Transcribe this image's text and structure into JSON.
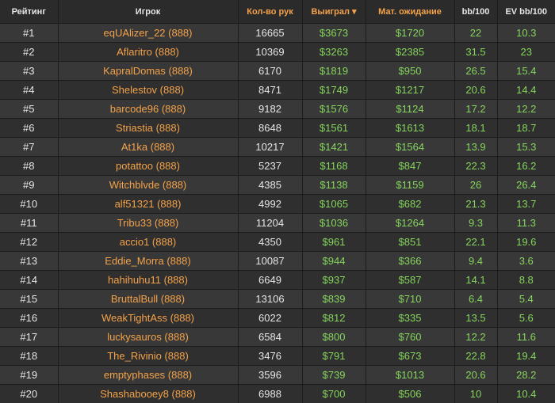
{
  "columns": [
    {
      "key": "rank",
      "label": "Рейтинг"
    },
    {
      "key": "player",
      "label": "Игрок"
    },
    {
      "key": "hands",
      "label": "Кол-во рук"
    },
    {
      "key": "won",
      "label": "Выиграл"
    },
    {
      "key": "ev",
      "label": "Мат. ожидание"
    },
    {
      "key": "bb",
      "label": "bb/100"
    },
    {
      "key": "evbb",
      "label": "EV bb/100"
    }
  ],
  "rows": [
    {
      "rank": "#1",
      "player": "eqUAlizer_22 (888)",
      "hands": "16665",
      "won": "$3673",
      "ev": "$1720",
      "bb": "22",
      "evbb": "10.3"
    },
    {
      "rank": "#2",
      "player": "Aflaritro (888)",
      "hands": "10369",
      "won": "$3263",
      "ev": "$2385",
      "bb": "31.5",
      "evbb": "23"
    },
    {
      "rank": "#3",
      "player": "KapralDomas (888)",
      "hands": "6170",
      "won": "$1819",
      "ev": "$950",
      "bb": "26.5",
      "evbb": "15.4"
    },
    {
      "rank": "#4",
      "player": "Shelestov (888)",
      "hands": "8471",
      "won": "$1749",
      "ev": "$1217",
      "bb": "20.6",
      "evbb": "14.4"
    },
    {
      "rank": "#5",
      "player": "barcode96 (888)",
      "hands": "9182",
      "won": "$1576",
      "ev": "$1124",
      "bb": "17.2",
      "evbb": "12.2"
    },
    {
      "rank": "#6",
      "player": "Striastia (888)",
      "hands": "8648",
      "won": "$1561",
      "ev": "$1613",
      "bb": "18.1",
      "evbb": "18.7"
    },
    {
      "rank": "#7",
      "player": "At1ka (888)",
      "hands": "10217",
      "won": "$1421",
      "ev": "$1564",
      "bb": "13.9",
      "evbb": "15.3"
    },
    {
      "rank": "#8",
      "player": "potattoo (888)",
      "hands": "5237",
      "won": "$1168",
      "ev": "$847",
      "bb": "22.3",
      "evbb": "16.2"
    },
    {
      "rank": "#9",
      "player": "Witchblvde (888)",
      "hands": "4385",
      "won": "$1138",
      "ev": "$1159",
      "bb": "26",
      "evbb": "26.4"
    },
    {
      "rank": "#10",
      "player": "alf51321 (888)",
      "hands": "4992",
      "won": "$1065",
      "ev": "$682",
      "bb": "21.3",
      "evbb": "13.7"
    },
    {
      "rank": "#11",
      "player": "Tribu33 (888)",
      "hands": "11204",
      "won": "$1036",
      "ev": "$1264",
      "bb": "9.3",
      "evbb": "11.3"
    },
    {
      "rank": "#12",
      "player": "accio1 (888)",
      "hands": "4350",
      "won": "$961",
      "ev": "$851",
      "bb": "22.1",
      "evbb": "19.6"
    },
    {
      "rank": "#13",
      "player": "Eddie_Morra (888)",
      "hands": "10087",
      "won": "$944",
      "ev": "$366",
      "bb": "9.4",
      "evbb": "3.6"
    },
    {
      "rank": "#14",
      "player": "hahihuhu11 (888)",
      "hands": "6649",
      "won": "$937",
      "ev": "$587",
      "bb": "14.1",
      "evbb": "8.8"
    },
    {
      "rank": "#15",
      "player": "BruttalBull (888)",
      "hands": "13106",
      "won": "$839",
      "ev": "$710",
      "bb": "6.4",
      "evbb": "5.4"
    },
    {
      "rank": "#16",
      "player": "WeakTightAss (888)",
      "hands": "6022",
      "won": "$812",
      "ev": "$335",
      "bb": "13.5",
      "evbb": "5.6"
    },
    {
      "rank": "#17",
      "player": "luckysauros (888)",
      "hands": "6584",
      "won": "$800",
      "ev": "$760",
      "bb": "12.2",
      "evbb": "11.6"
    },
    {
      "rank": "#18",
      "player": "The_Rivinio (888)",
      "hands": "3476",
      "won": "$791",
      "ev": "$673",
      "bb": "22.8",
      "evbb": "19.4"
    },
    {
      "rank": "#19",
      "player": "emptyphases (888)",
      "hands": "3596",
      "won": "$739",
      "ev": "$1013",
      "bb": "20.6",
      "evbb": "28.2"
    },
    {
      "rank": "#20",
      "player": "Shashabooey8 (888)",
      "hands": "6988",
      "won": "$700",
      "ev": "$506",
      "bb": "10",
      "evbb": "10.4"
    }
  ]
}
